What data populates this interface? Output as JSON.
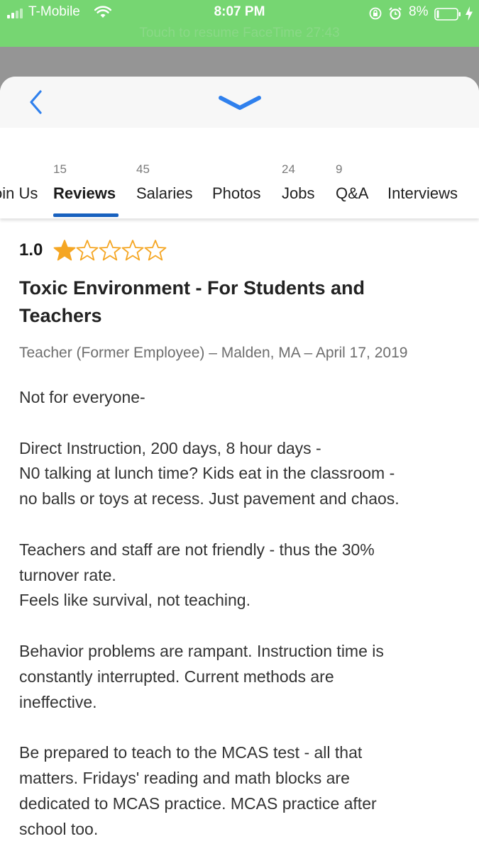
{
  "status_bar": {
    "carrier": "T-Mobile",
    "time": "8:07 PM",
    "battery": "8%",
    "facetime_banner": "Touch to resume FaceTime 27:43",
    "background_color": "#76d672"
  },
  "header": {
    "back_icon": "chevron-left-icon",
    "collapse_icon": "chevron-down-icon",
    "accent_color": "#2f80ed"
  },
  "tabs": [
    {
      "label": "Join Us",
      "count": ""
    },
    {
      "label": "Reviews",
      "count": "15",
      "active": true
    },
    {
      "label": "Salaries",
      "count": "45"
    },
    {
      "label": "Photos",
      "count": ""
    },
    {
      "label": "Jobs",
      "count": "24"
    },
    {
      "label": "Q&A",
      "count": "9"
    },
    {
      "label": "Interviews",
      "count": ""
    }
  ],
  "review": {
    "rating": "1.0",
    "rating_stars": 1,
    "rating_max": 5,
    "star_color": "#f5a623",
    "title": "Toxic Environment - For Students and Teachers",
    "meta": "Teacher (Former Employee) –  Malden, MA – April 17, 2019",
    "body": [
      [
        "Not for everyone-"
      ],
      [
        "Direct Instruction, 200 days, 8 hour days -",
        "N0 talking at lunch time? Kids eat in the classroom -",
        "no balls or toys at recess. Just pavement and chaos."
      ],
      [
        "Teachers and staff are not friendly - thus the 30%",
        "turnover rate.",
        "Feels like survival, not teaching."
      ],
      [
        "Behavior problems are rampant. Instruction time is",
        "constantly interrupted. Current methods are",
        "ineffective."
      ],
      [
        "Be prepared to teach to the MCAS test - all that",
        "matters. Fridays' reading and math blocks are",
        "dedicated to MCAS practice. MCAS practice after",
        "school too."
      ]
    ]
  }
}
